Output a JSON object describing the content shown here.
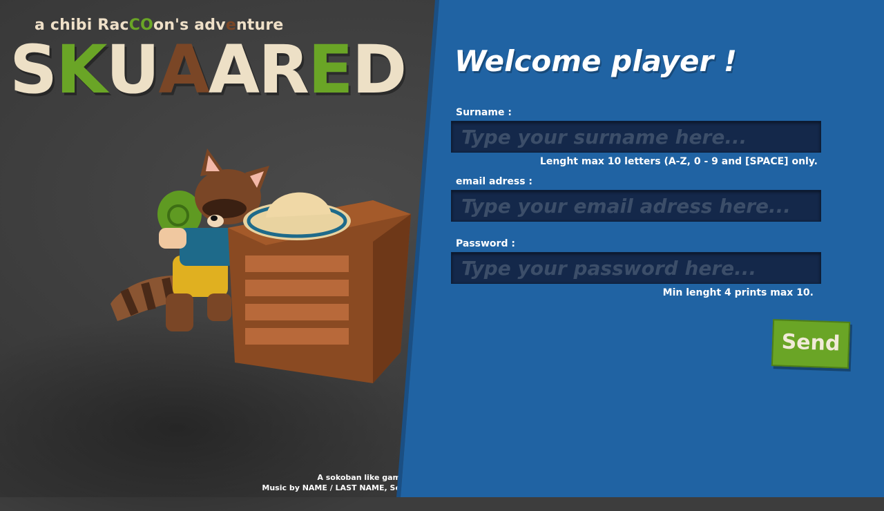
{
  "branding": {
    "tagline_parts": [
      "a chibi Rac",
      "C",
      "O",
      "on's adv",
      "e",
      "nture"
    ],
    "title_letters": [
      "S",
      "K",
      "U",
      "A",
      "A",
      "R",
      "E",
      "D"
    ],
    "title_colors": [
      "#ede0c6",
      "#6aa526",
      "#ede0c6",
      "#7a4626",
      "#ede0c6",
      "#ede0c6",
      "#6aa526",
      "#ede0c6"
    ]
  },
  "credits": {
    "line1": "A sokoban like gam",
    "line2": "Music by NAME / LAST NAME, So"
  },
  "form": {
    "welcome": "Welcome player !",
    "surname_label": "Surname :",
    "surname_placeholder": "Type your surname here...",
    "surname_hint": "Lenght max 10 letters (A-Z, 0 - 9 and [SPACE] only.",
    "email_label": "email adress :",
    "email_placeholder": "Type your email adress here...",
    "password_label": "Password :",
    "password_placeholder": "Type your password here...",
    "password_hint": "Min lenght 4 prints max 10.",
    "send_label": "Send"
  },
  "colors": {
    "panel_blue": "#2063a3",
    "field_dark": "#14284a",
    "send_green": "#6aa526",
    "cream": "#ede0c6",
    "brown": "#7a4626"
  }
}
